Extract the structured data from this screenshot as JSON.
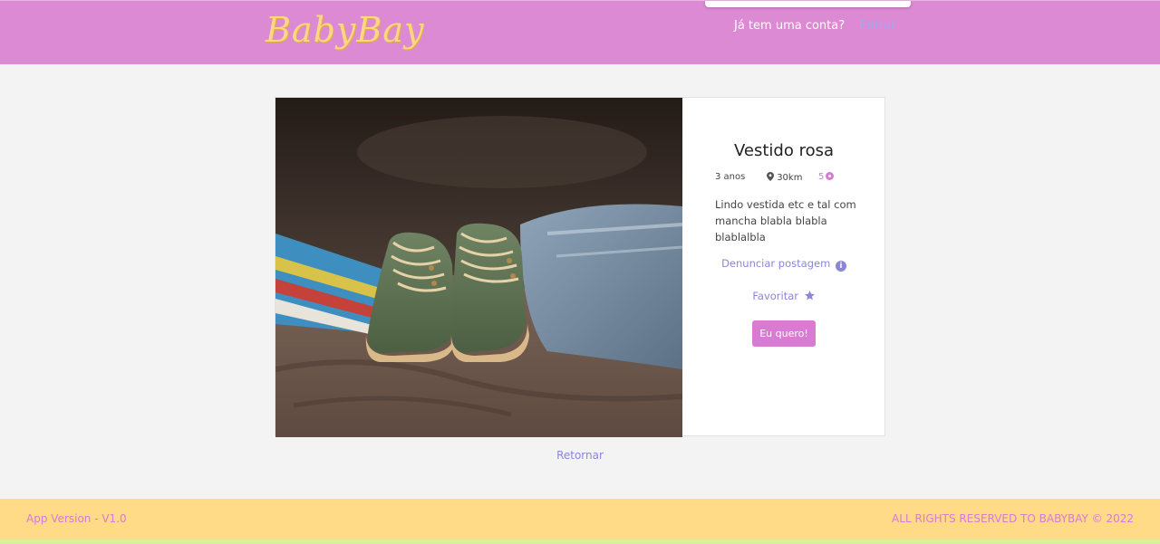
{
  "header": {
    "logo_text": "BabyBay",
    "account_question": "Já tem uma conta?",
    "login_label": "Entrar"
  },
  "product": {
    "image_alt": "Par de botinhas de bebê verdes sobre roupas",
    "title": "Vestido rosa",
    "age": "3 anos",
    "distance": "30km",
    "points": "5",
    "description": "Lindo vestida etc e tal com mancha blabla blabla blablalbla",
    "report_label": "Denunciar postagem",
    "favorite_label": "Favoritar",
    "want_label": "Eu quero!"
  },
  "navigation": {
    "back_label": "Retornar"
  },
  "footer": {
    "version": "App Version - V1.0",
    "rights": "ALL RIGHTS RESERVED TO BABYBAY © 2022"
  },
  "colors": {
    "header_bg": "#dc8ad4",
    "footer_bg": "#ffdb87",
    "accent_pink": "#d97ad3",
    "link_lavender": "#8a86d8",
    "logo_yellow": "#fbd685"
  },
  "icons": {
    "location": "map-pin-icon",
    "points": "coin-icon",
    "report": "info-icon",
    "favorite": "star-icon"
  }
}
